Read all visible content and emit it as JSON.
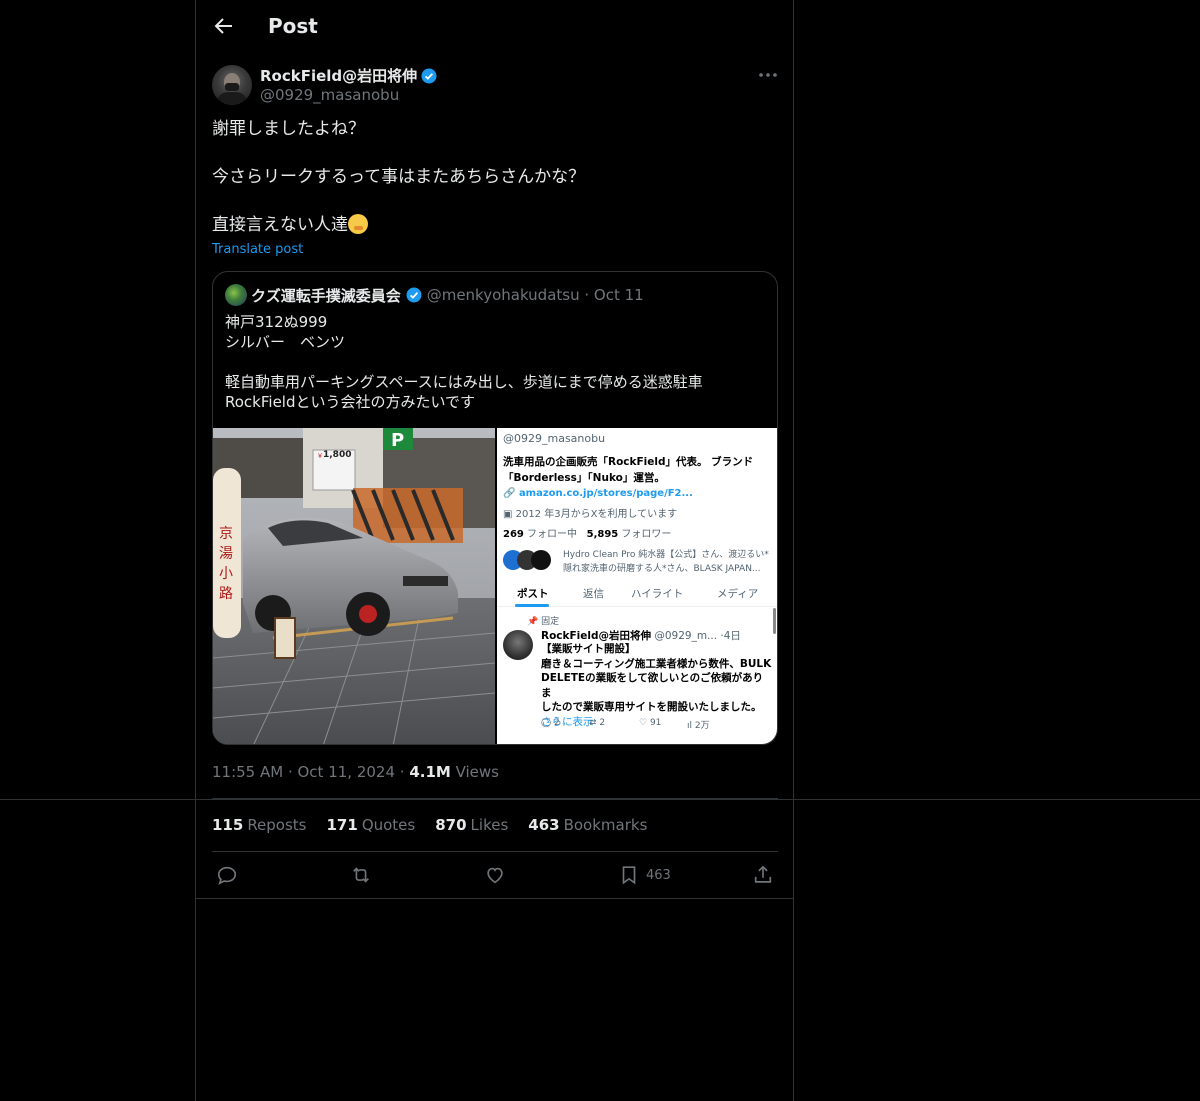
{
  "header": {
    "title": "Post"
  },
  "post": {
    "display_name": "RockField@岩田将伸",
    "handle": "@0929_masanobu",
    "lines": [
      "謝罪しましたよね？",
      "今さらリークするって事はまたあちらさんかな？",
      "直接言えない人達"
    ],
    "translate": "Translate post",
    "time": "11:55 AM · Oct 11, 2024 · ",
    "views_count": "4.1M",
    "views_label": " Views"
  },
  "quote": {
    "display_name": "クズ運転手撲滅委員会",
    "meta": "@menkyohakudatsu · Oct 11",
    "lines": [
      "神戸312ぬ999",
      "シルバー　ベンツ",
      "軽自動車用パーキングスペースにはみ出し、歩道にまで停める迷惑駐車",
      "RockFieldという会社の方みたいです"
    ],
    "screenshot": {
      "handle": "@0929_masanobu",
      "bio1": "洗車用品の企画販売「RockField」代表。 ブランド",
      "bio2": "「Borderless」「Nuko」運営。",
      "link": "amazon.co.jp/stores/page/F2...",
      "joined": "2012 年3月からXを利用しています",
      "following": "269",
      "following_label": " フォロー中",
      "followers": "5,895",
      "followers_label": " フォロワー",
      "followed_by1": "Hydro Clean Pro 純水器【公式】さん、渡辺るい*",
      "followed_by2": "隠れ家洗車の研磨する人*さん、BLASK JAPAN...",
      "tabs": [
        "ポスト",
        "返信",
        "ハイライト",
        "メディア"
      ],
      "pinned": "固定",
      "tweet_name": "RockField@岩田将伸",
      "tweet_meta": "@0929_m... ·4日",
      "tweet_l1": "【業販サイト開設】",
      "tweet_l2": "磨き＆コーティング施工業者様から数件、BULK",
      "tweet_l3": "DELETEの業販をして欲しいとのご依頼がありま",
      "tweet_l4": "したので業販専用サイトを開設いたしました。",
      "tweet_more": "さらに表示",
      "c_reply": "2",
      "c_rt": "2",
      "c_like": "91",
      "c_views": "2万"
    },
    "photo": {
      "price": "1,800",
      "sign1": "京",
      "sign2": "湯",
      "sign3": "小",
      "sign4": "路"
    }
  },
  "stats": {
    "reposts_count": "115",
    "reposts_label": "Reposts",
    "quotes_count": "171",
    "quotes_label": "Quotes",
    "likes_count": "870",
    "likes_label": "Likes",
    "bookmarks_count": "463",
    "bookmarks_label": "Bookmarks"
  },
  "actions": {
    "bookmark_count": "463"
  },
  "colors": {
    "accent": "#1d9bf0",
    "muted": "#71767b",
    "border": "#2f3336",
    "text": "#e7e9ea"
  },
  "icons": [
    "back-arrow-icon",
    "verified-badge-icon",
    "more-icon",
    "reply-icon",
    "repost-icon",
    "like-icon",
    "bookmark-icon",
    "share-icon"
  ]
}
